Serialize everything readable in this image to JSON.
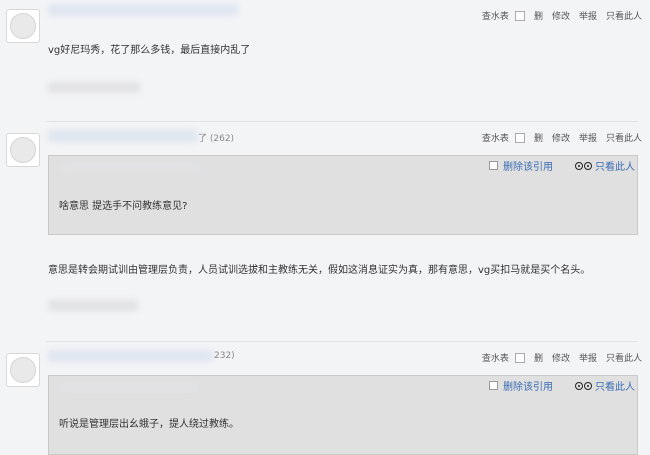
{
  "ops": {
    "water": "查水表",
    "del": "删",
    "edit": "修改",
    "report": "举报",
    "only": "只看此人"
  },
  "quote_ops": {
    "del_quote": "删除该引用",
    "only": "只看此人"
  },
  "posts": [
    {
      "meta": "",
      "text": "vg好尼玛秀，花了那么多钱，最后直接内乱了"
    },
    {
      "meta": "了 (262)",
      "quote": "啥意思 提选手不问教练意见?",
      "text": "意思是转会期试训由管理层负责，人员试训选拔和主教练无关，假如这消息证实为真，那有意思，vg买扣马就是买个名头。"
    },
    {
      "meta": "232)",
      "quote": "听说是管理层出幺蛾子，提人绕过教练。"
    }
  ]
}
